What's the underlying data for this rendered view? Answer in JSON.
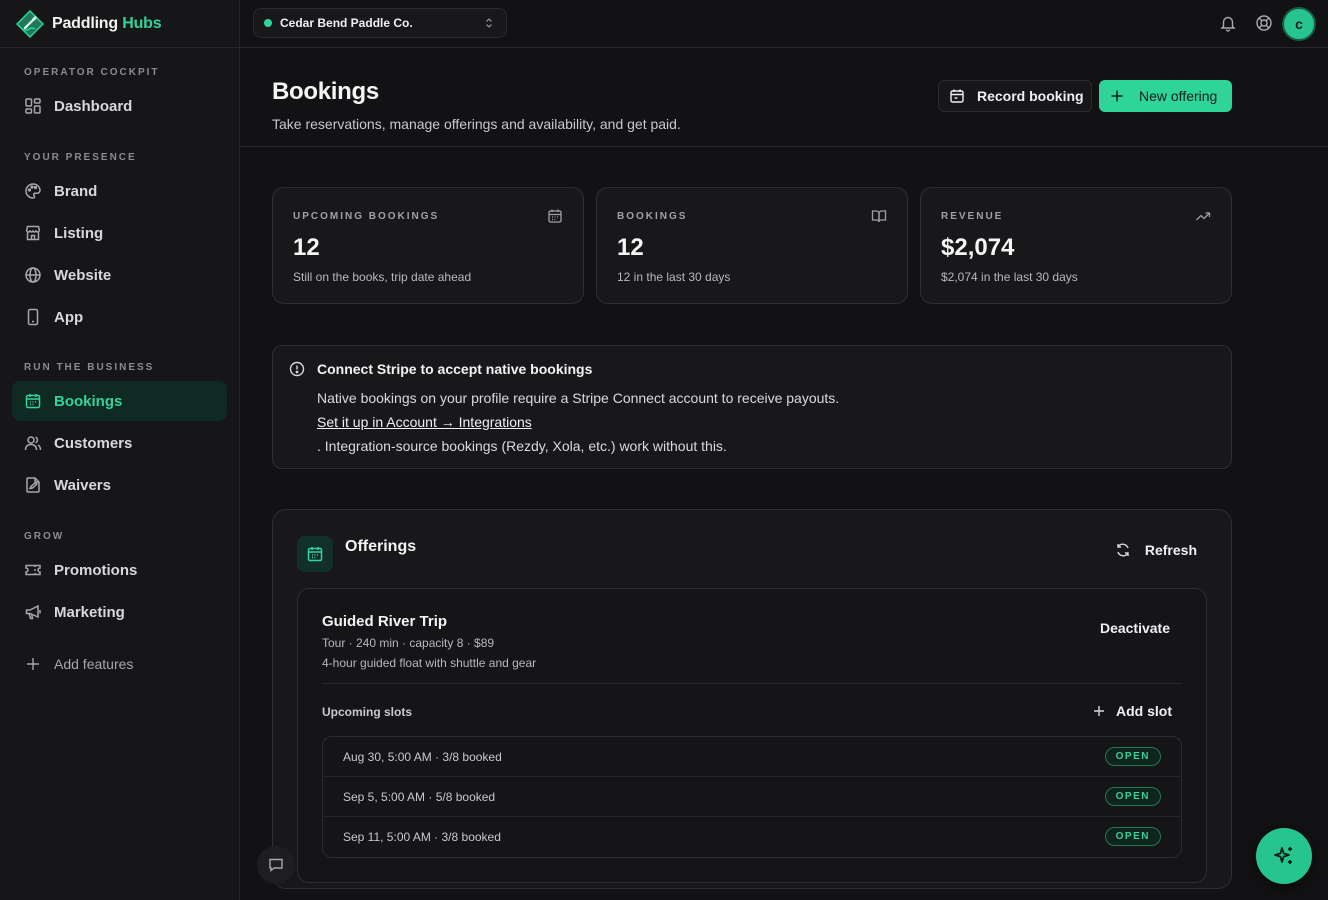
{
  "brand": {
    "name_a": "Paddling",
    "name_b": "Hubs"
  },
  "sidebar": {
    "sections": [
      {
        "label": "OPERATOR COCKPIT",
        "items": [
          {
            "label": "Dashboard",
            "icon": "dashboard-icon"
          }
        ]
      },
      {
        "label": "YOUR PRESENCE",
        "items": [
          {
            "label": "Brand",
            "icon": "palette-icon"
          },
          {
            "label": "Listing",
            "icon": "store-icon"
          },
          {
            "label": "Website",
            "icon": "globe-icon"
          },
          {
            "label": "App",
            "icon": "smartphone-icon"
          }
        ]
      },
      {
        "label": "RUN THE BUSINESS",
        "items": [
          {
            "label": "Bookings",
            "icon": "calendar-icon",
            "active": true
          },
          {
            "label": "Customers",
            "icon": "users-icon"
          },
          {
            "label": "Waivers",
            "icon": "file-signature-icon"
          }
        ]
      },
      {
        "label": "GROW",
        "items": [
          {
            "label": "Promotions",
            "icon": "ticket-icon"
          },
          {
            "label": "Marketing",
            "icon": "megaphone-icon"
          }
        ]
      }
    ],
    "add_features": "Add features"
  },
  "topbar": {
    "org_name": "Cedar Bend Paddle Co.",
    "avatar_initial": "c"
  },
  "page": {
    "title": "Bookings",
    "subtitle": "Take reservations, manage offerings and availability, and get paid.",
    "record_booking": "Record booking",
    "new_offering": "New offering"
  },
  "stats": [
    {
      "label": "UPCOMING BOOKINGS",
      "value": "12",
      "caption": "Still on the books, trip date ahead",
      "icon": "calendar-icon"
    },
    {
      "label": "BOOKINGS",
      "value": "12",
      "caption": "12 in the last 30 days",
      "icon": "book-open-icon"
    },
    {
      "label": "REVENUE",
      "value": "$2,074",
      "caption": "$2,074 in the last 30 days",
      "icon": "trending-up-icon"
    }
  ],
  "alert": {
    "title": "Connect Stripe to accept native bookings",
    "line1": "Native bookings on your profile require a Stripe Connect account to receive payouts.",
    "link": "Set it up in Account → Integrations",
    "line3": ". Integration-source bookings (Rezdy, Xola, etc.) work without this."
  },
  "offerings": {
    "title": "Offerings",
    "refresh": "Refresh",
    "items": [
      {
        "name": "Guided River Trip",
        "meta": "Tour · 240 min · capacity 8 · $89",
        "description": "4-hour guided float with shuttle and gear",
        "deactivate": "Deactivate",
        "slots_label": "Upcoming slots",
        "add_slot": "Add slot",
        "slots": [
          {
            "text": "Aug 30, 5:00 AM · 3/8 booked",
            "status": "OPEN"
          },
          {
            "text": "Sep 5, 5:00 AM · 5/8 booked",
            "status": "OPEN"
          },
          {
            "text": "Sep 11, 5:00 AM · 3/8 booked",
            "status": "OPEN"
          }
        ]
      }
    ]
  },
  "colors": {
    "accent": "#2fd49a",
    "background": "#121214",
    "surface": "#18181b"
  }
}
